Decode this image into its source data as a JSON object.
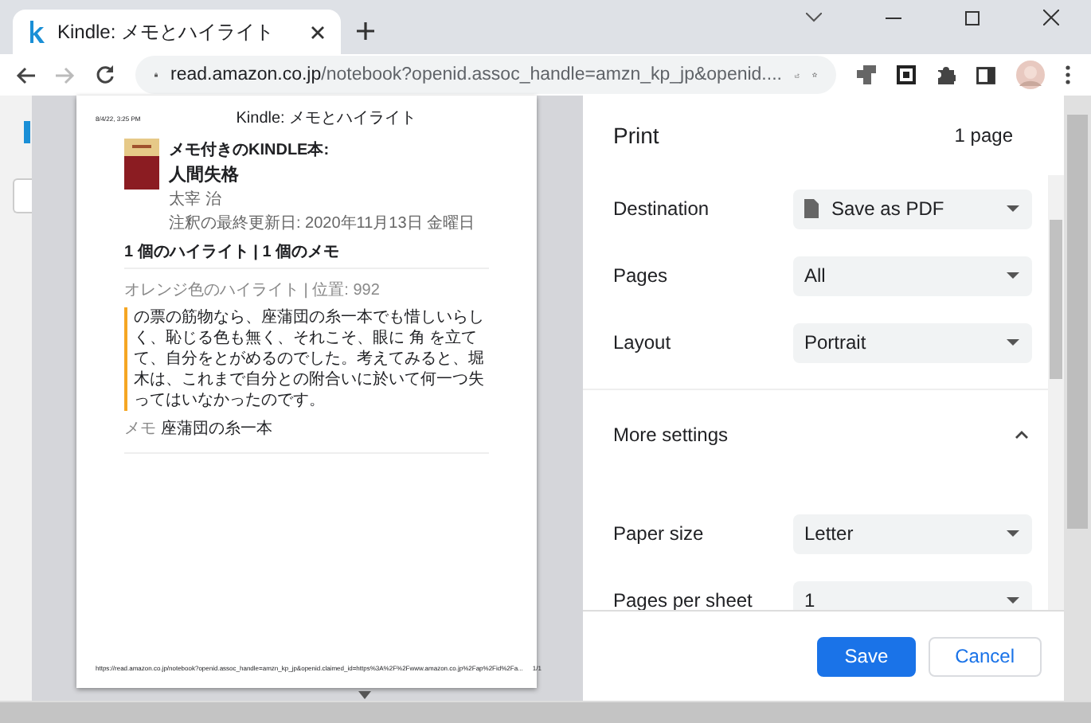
{
  "browser": {
    "tab": {
      "title": "Kindle: メモとハイライト",
      "selected": true
    },
    "url_host": "read.amazon.co.jp",
    "url_path": "/notebook?openid.assoc_handle=amzn_kp_jp&openid...."
  },
  "preview": {
    "header_date": "8/4/22, 3:25 PM",
    "header_title": "Kindle: メモとハイライト",
    "book_label": "メモ付きのKINDLE本:",
    "book_title": "人間失格",
    "author": "太宰 治",
    "updated": "注釈の最終更新日: 2020年11月13日 金曜日",
    "counts": "1 個のハイライト |  1 個のメモ",
    "highlight": {
      "meta": "オレンジ色のハイライト | 位置: 992",
      "color": "#f5a623",
      "text": "の票の筋物なら、座蒲団の糸一本でも惜しいらしく、恥じる色も無く、それこそ、眼に 角 を立てて、自分をとがめるのでした。考えてみると、堀木は、これまで自分との附合いに於いて何一つ失ってはいなかったのです。",
      "memo_label": "メモ",
      "memo": "座蒲団の糸一本"
    },
    "footer_url": "https://read.amazon.co.jp/notebook?openid.assoc_handle=amzn_kp_jp&openid.claimed_id=https%3A%2F%2Fwww.amazon.co.jp%2Fap%2Fid%2Fa...",
    "footer_page": "1/1"
  },
  "print": {
    "title": "Print",
    "page_count": "1 page",
    "settings": [
      {
        "label": "Destination",
        "value": "Save as PDF",
        "kind": "destination"
      },
      {
        "label": "Pages",
        "value": "All",
        "kind": "select"
      },
      {
        "label": "Layout",
        "value": "Portrait",
        "kind": "select"
      }
    ],
    "more_settings": {
      "label": "More settings",
      "expanded": true
    },
    "more": [
      {
        "label": "Paper size",
        "value": "Letter"
      },
      {
        "label": "Pages per sheet",
        "value": "1"
      }
    ],
    "buttons": [
      {
        "label": "Save",
        "kind": "primary"
      },
      {
        "label": "Cancel",
        "kind": "secondary"
      }
    ]
  }
}
